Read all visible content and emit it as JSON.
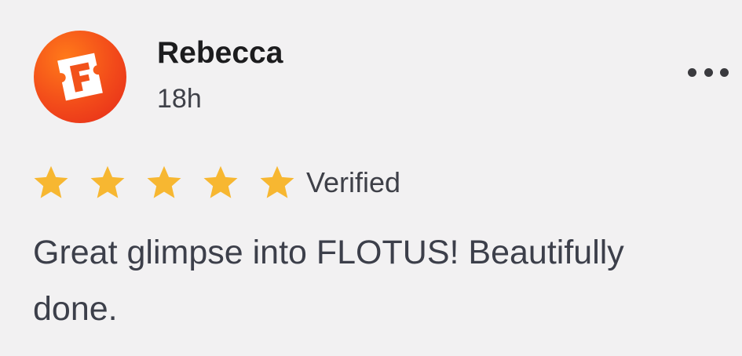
{
  "review": {
    "author": "Rebecca",
    "time_ago": "18h",
    "avatar_icon": "fandango-logo-icon",
    "rating": 5,
    "rating_max": 5,
    "verified_label": "Verified",
    "text": "Great glimpse into FLOTUS! Beautifully done.",
    "star_color": "#f7b731",
    "avatar_color": "#f24a1a",
    "more_icon": "more-options-icon"
  }
}
